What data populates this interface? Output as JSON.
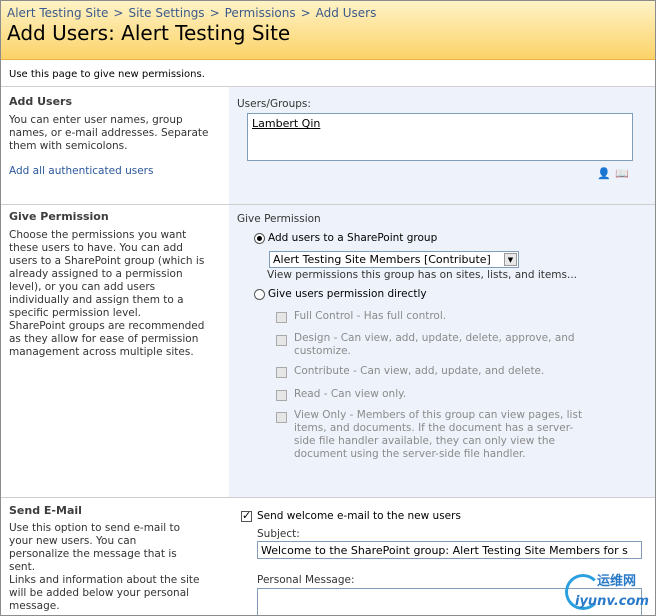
{
  "breadcrumb": {
    "items": [
      "Alert Testing Site",
      "Site Settings",
      "Permissions"
    ],
    "current": "Add Users",
    "separator": ">"
  },
  "page": {
    "title": "Add Users: Alert Testing Site",
    "intro": "Use this page to give new permissions."
  },
  "add_users": {
    "heading": "Add Users",
    "description": "You can enter user names, group names, or e-mail addresses. Separate them with semicolons.",
    "link": "Add all authenticated users",
    "field_label": "Users/Groups:",
    "value": "Lambert Qin",
    "check_names_icon": "check-names-icon",
    "browse_icon": "address-book-icon"
  },
  "give_permission": {
    "heading": "Give Permission",
    "description_1": "Choose the permissions you want these users to have. You can add users to a SharePoint group (which is already assigned to a permission level), or you can add users individually and assign them to a specific permission level.",
    "description_2": "SharePoint groups are recommended as they allow for ease of permission management across multiple sites.",
    "field_label": "Give Permission",
    "option_group": "Add users to a SharePoint group",
    "group_selected": "Alert Testing Site Members [Contribute]",
    "group_link": "View permissions this group has on sites, lists, and items...",
    "option_direct": "Give users permission directly",
    "levels": [
      "Full Control - Has full control.",
      "Design - Can view, add, update, delete, approve, and customize.",
      "Contribute - Can view, add, update, and delete.",
      "Read - Can view only.",
      "View Only - Members of this group can view pages, list items, and documents. If the document has a server-side file handler available, they can only view the document using the server-side file handler."
    ]
  },
  "send_email": {
    "heading": "Send E-Mail",
    "description_1": "Use this option to send e-mail to your new users. You can personalize the message that is sent.",
    "description_2": "Links and information about the site will be added below your personal message.",
    "checkbox_label": "Send welcome e-mail to the new users",
    "subject_label": "Subject:",
    "subject_value": "Welcome to the SharePoint group: Alert Testing Site Members for s",
    "message_label": "Personal Message:"
  },
  "watermark": {
    "cn": "运维网",
    "en": "iyunv.com"
  },
  "colors": {
    "header_gradient_top": "#fff3c6",
    "header_gradient_bottom": "#fbd268",
    "link": "#2b579a",
    "pane": "#eef3fb"
  }
}
